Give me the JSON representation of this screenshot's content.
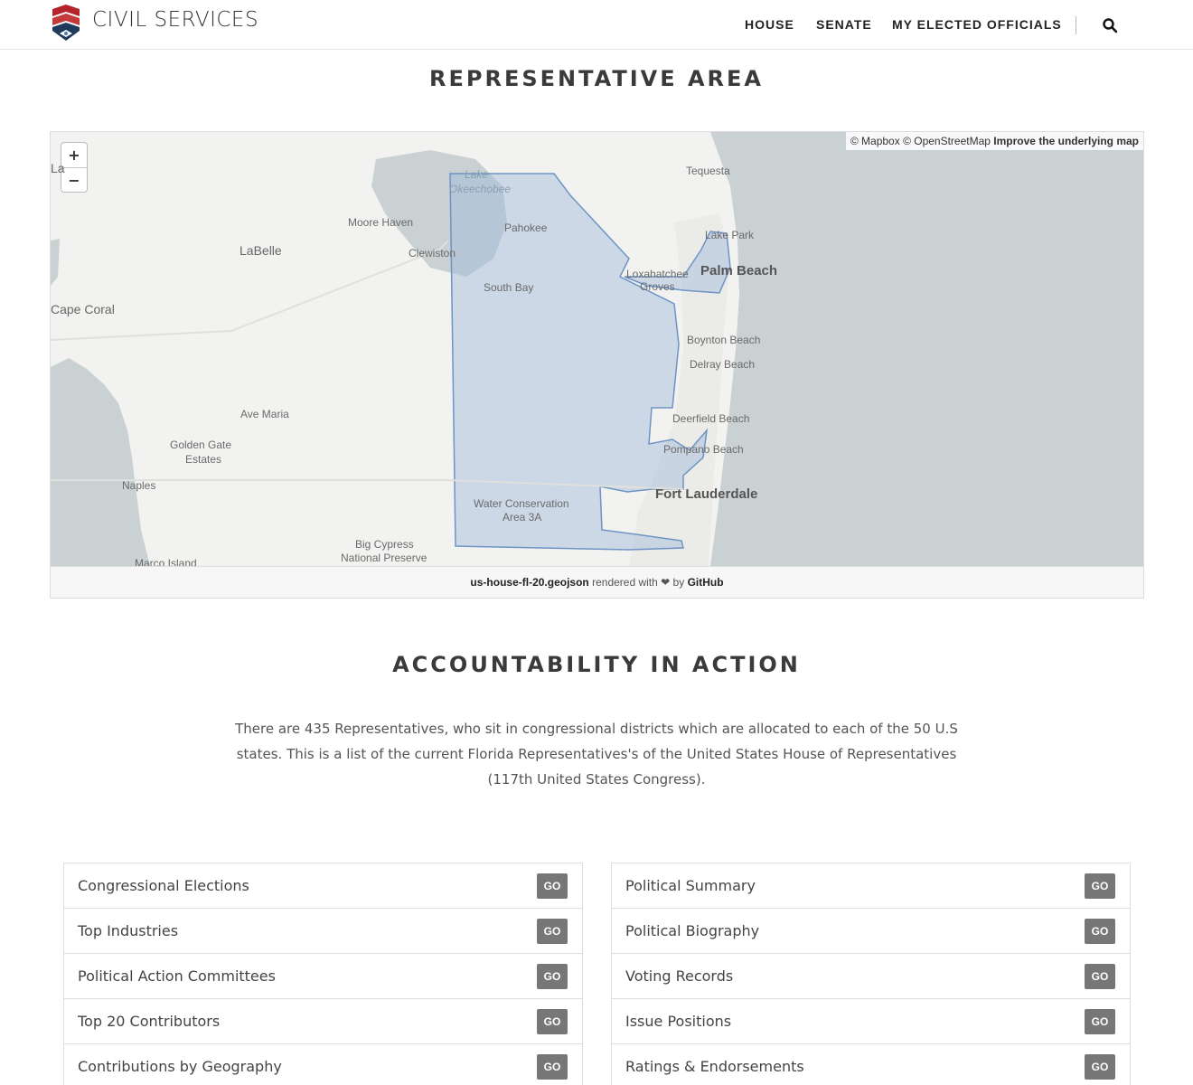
{
  "header": {
    "brand": "CIVIL SERVICES",
    "nav": {
      "house": "HOUSE",
      "senate": "SENATE",
      "officials": "MY ELECTED OFFICIALS"
    }
  },
  "rep_area": {
    "title": "REPRESENTATIVE AREA",
    "map": {
      "zoom_in": "+",
      "zoom_out": "−",
      "attribution": {
        "mapbox": "© Mapbox",
        "osm": "© OpenStreetMap",
        "improve": "Improve the underlying map"
      },
      "labels": {
        "lake": "Lake",
        "okeechobee": "Okeechobee",
        "tequesta": "Tequesta",
        "moore_haven": "Moore Haven",
        "pahokee": "Pahokee",
        "labelle": "LaBelle",
        "clewiston": "Clewiston",
        "lake_park": "Lake Park",
        "loxahatchee": "Loxahatchee",
        "groves": "Groves",
        "palm_beach": "Palm Beach",
        "south_bay": "South Bay",
        "cape_coral": "Cape Coral",
        "boynton": "Boynton Beach",
        "delray": "Delray Beach",
        "ave_maria": "Ave Maria",
        "deerfield": "Deerfield Beach",
        "golden_gate": "Golden Gate",
        "estates": "Estates",
        "pompano": "Pompano Beach",
        "naples": "Naples",
        "fort_lauderdale": "Fort Lauderdale",
        "wca1": "Water Conservation",
        "wca2": "Area 3A",
        "big_cypress1": "Big Cypress",
        "big_cypress2": "National Preserve",
        "marco": "Marco Island",
        "edge_la": "La"
      },
      "footer": {
        "file": "us-house-fl-20.geojson",
        "text": "rendered with ❤ by",
        "github": "GitHub"
      }
    }
  },
  "accountability": {
    "title": "ACCOUNTABILITY IN ACTION",
    "intro": "There are 435 Representatives, who sit in congressional districts which are allocated to each of the 50 U.S states. This is a list of the current Florida Representatives's of the United States House of Representatives (117th United States Congress).",
    "go_label": "GO",
    "left_items": [
      "Congressional Elections",
      "Top Industries",
      "Political Action Committees",
      "Top 20 Contributors",
      "Contributions by Geography"
    ],
    "right_items": [
      "Political Summary",
      "Political Biography",
      "Voting Records",
      "Issue Positions",
      "Ratings & Endorsements"
    ]
  }
}
